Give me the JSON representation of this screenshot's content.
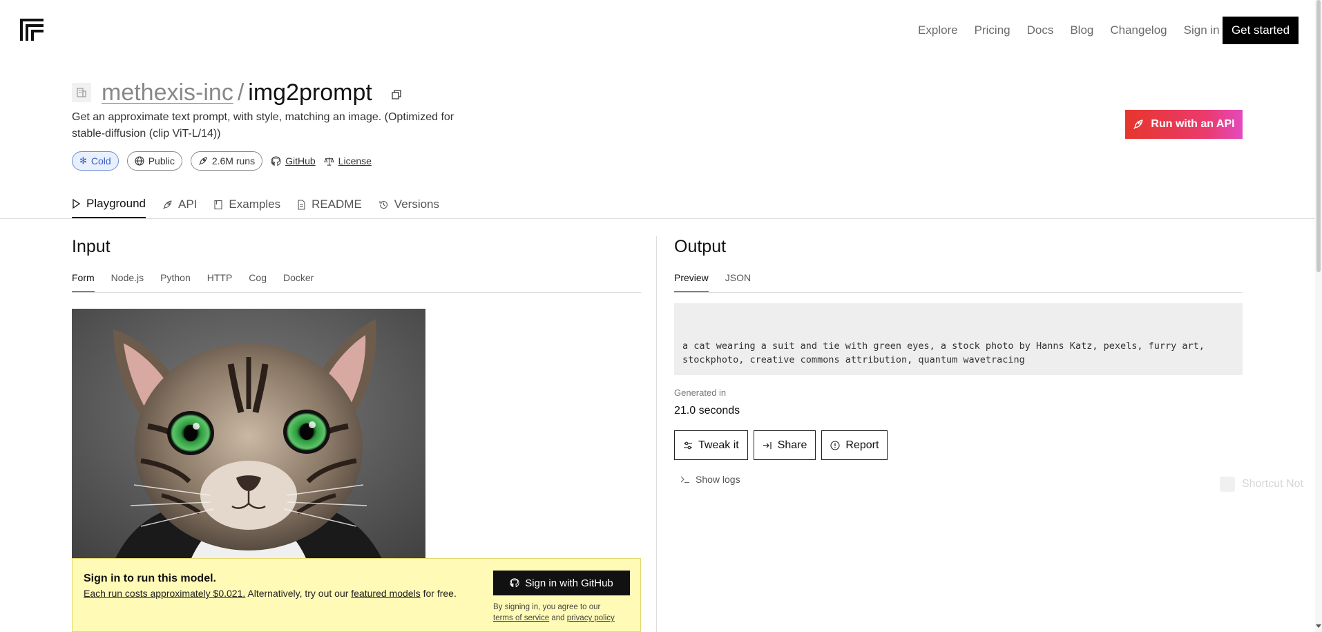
{
  "nav": {
    "links": [
      "Explore",
      "Pricing",
      "Docs",
      "Blog",
      "Changelog",
      "Sign in"
    ],
    "cta": "Get started"
  },
  "model": {
    "owner": "methexis-inc",
    "separator": "/",
    "name": "img2prompt",
    "description": "Get an approximate text prompt, with style, matching an image. (Optimized for stable-diffusion (clip ViT-L/14))",
    "status": "Cold",
    "visibility": "Public",
    "runs": "2.6M runs",
    "github_label": "GitHub",
    "license_label": "License",
    "api_button": "Run with an API"
  },
  "tabs": [
    "Playground",
    "API",
    "Examples",
    "README",
    "Versions"
  ],
  "input": {
    "title": "Input",
    "subtabs": [
      "Form",
      "Node.js",
      "Python",
      "HTTP",
      "Cog",
      "Docker"
    ]
  },
  "banner": {
    "title": "Sign in to run this model.",
    "cost_link": "Each run costs approximately $0.021.",
    "alt_text": "Alternatively, try out our",
    "featured_link": "featured models",
    "free_text": "for free.",
    "github_button": "Sign in with GitHub",
    "fine_1": "By signing in, you agree to our",
    "terms_link": "terms of service",
    "and_text": "and",
    "privacy_link": "privacy policy"
  },
  "output": {
    "title": "Output",
    "subtabs": [
      "Preview",
      "JSON"
    ],
    "text": "a cat wearing a suit and tie with green eyes, a stock photo by Hanns Katz, pexels, furry art, stockphoto, creative commons attribution, quantum wavetracing",
    "generated_label": "Generated in",
    "generated_value": "21.0 seconds",
    "buttons": [
      "Tweak it",
      "Share",
      "Report"
    ],
    "show_logs": "Show logs",
    "shortcut": "Shortcut Not"
  },
  "colors": {
    "api_gradient_start": "#e6362b",
    "api_gradient_end": "#e44abf",
    "banner_bg": "#fffab6",
    "cold_bg": "#e8f0fe"
  }
}
